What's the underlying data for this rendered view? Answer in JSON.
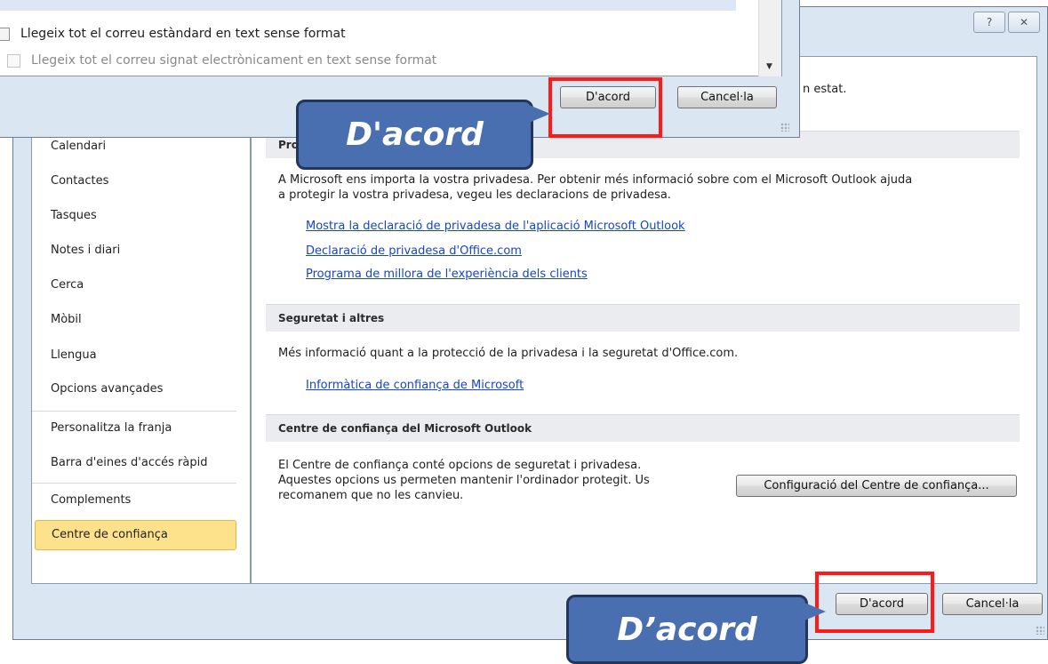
{
  "title_buttons": {
    "help": "?",
    "close": "✕"
  },
  "sub_dialog": {
    "options": [
      {
        "label": "Llegeix tot el correu estàndard en text sense format",
        "checked": false,
        "enabled": true
      },
      {
        "label": "Llegeix tot el correu signat electrònicament en text sense format",
        "checked": false,
        "enabled": false
      }
    ],
    "ok_label": "D'acord",
    "cancel_label": "Cancel·la"
  },
  "nav": {
    "items": [
      {
        "label": "Calendari",
        "selected": false
      },
      {
        "label": "Contactes",
        "selected": false
      },
      {
        "label": "Tasques",
        "selected": false
      },
      {
        "label": "Notes i diari",
        "selected": false
      },
      {
        "label": "Cerca",
        "selected": false
      },
      {
        "label": "Mòbil",
        "selected": false
      },
      {
        "label": "Llengua",
        "selected": false
      },
      {
        "label": "Opcions avançades",
        "selected": false
      },
      {
        "label": "Personalitza la franja",
        "selected": false
      },
      {
        "label": "Barra d'eines d'accés ràpid",
        "selected": false
      },
      {
        "label": "Complements",
        "selected": false
      },
      {
        "label": "Centre de confiança",
        "selected": true
      }
    ]
  },
  "content": {
    "intro_tail": "n estat.",
    "privacy": {
      "header_partial": "Pro",
      "paragraph_line1": "A Microsoft ens importa la vostra privadesa. Per obtenir més informació sobre com el Microsoft Outlook ajuda",
      "paragraph_line2": "a protegir la vostra privadesa, vegeu les declaracions de privadesa.",
      "links": [
        "Mostra la declaració de privadesa de l'aplicació Microsoft Outlook",
        "Declaració de privadesa d'Office.com",
        "Programa de millora de l'experiència dels clients"
      ]
    },
    "security": {
      "header": "Seguretat i altres",
      "paragraph": "Més informació quant a la protecció de la privadesa i la seguretat d'Office.com.",
      "link": "Informàtica de confiança de Microsoft"
    },
    "trust_center": {
      "header": "Centre de confiança del Microsoft Outlook",
      "line1": "El Centre de confiança conté opcions de seguretat i privadesa.",
      "line2": "Aquestes opcions us permeten mantenir l'ordinador protegit. Us",
      "line3": "recomanem que no les canvieu.",
      "settings_button": "Configuració del Centre de confiança..."
    }
  },
  "footer": {
    "ok_label": "D'acord",
    "cancel_label": "Cancel·la"
  },
  "callouts": {
    "top": "D'acord",
    "bottom": "D’acord"
  },
  "colors": {
    "highlight_box": "#ff1a1a",
    "callout_fill": "#4a6fb0",
    "selected_nav": "#fde28b",
    "link": "#1645c8"
  }
}
